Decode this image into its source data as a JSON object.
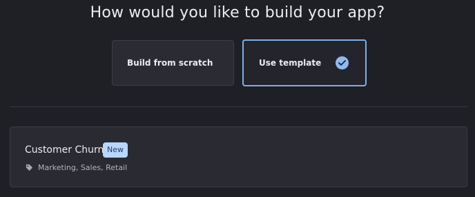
{
  "header": {
    "title": "How would you like to build your app?"
  },
  "options": {
    "scratch_label": "Build from scratch",
    "template_label": "Use template",
    "selected": "Use template"
  },
  "template_card": {
    "title": "Customer Churn",
    "badge": "New",
    "tags": "Marketing, Sales, Retail"
  },
  "icons": {
    "check": "check-circle-icon",
    "tag": "tag-icon"
  },
  "colors": {
    "accent": "#8fbaf0",
    "badge_bg": "#b9d6fb"
  }
}
